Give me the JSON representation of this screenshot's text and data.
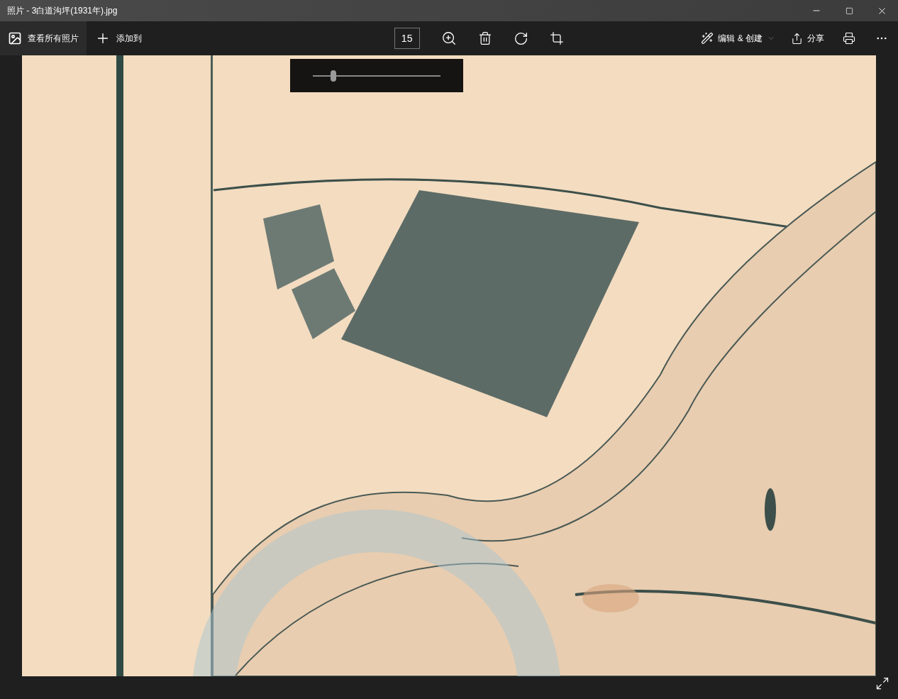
{
  "window": {
    "title": "照片 - 3白道沟坪(1931年).jpg"
  },
  "toolbar": {
    "view_all": "查看所有照片",
    "add_to": "添加到",
    "zoom_value": "15",
    "edit_create": "编辑 & 创建",
    "share": "分享"
  },
  "zoom_slider": {
    "level": 0.16
  }
}
